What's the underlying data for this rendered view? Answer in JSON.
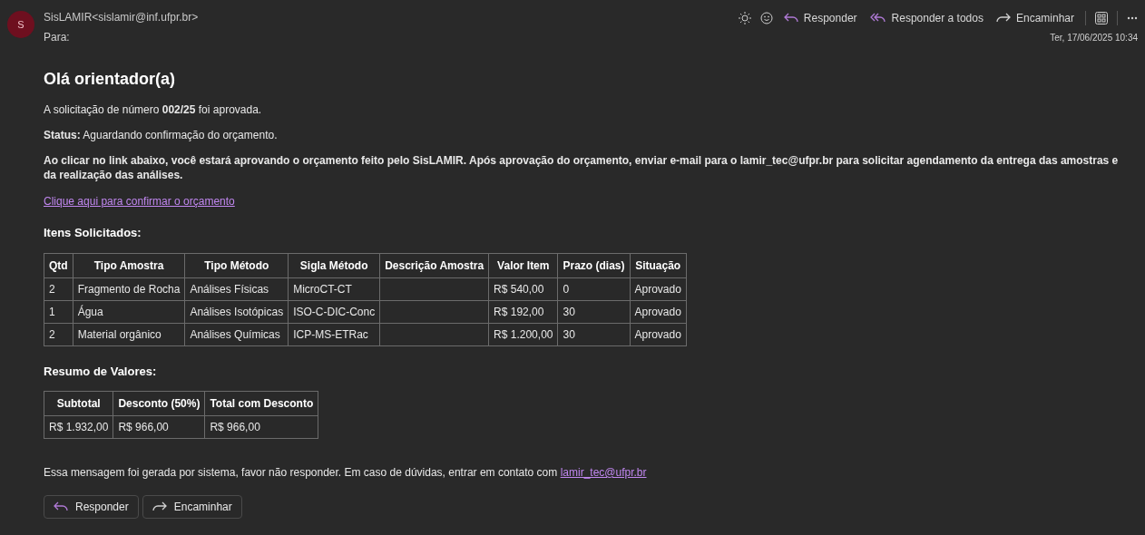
{
  "header": {
    "avatar": "S",
    "sender": "SisLAMIR<sislamir@inf.ufpr.br>",
    "to_label": "Para:",
    "date": "Ter, 17/06/2025 10:34",
    "actions": [
      {
        "kind": "reply",
        "label": "Responder"
      },
      {
        "kind": "reply_all",
        "label": "Responder a todos"
      },
      {
        "kind": "forward",
        "label": "Encaminhar"
      }
    ]
  },
  "body": {
    "greeting": "Olá orientador(a)",
    "paragraphs": [
      {
        "text": "A solicitação de número **002/25** foi aprovada.",
        "bold": false
      },
      {
        "text": "**Status:** Aguardando confirmação do orçamento.",
        "bold": false
      },
      {
        "text": "Ao clicar no link abaixo, você estará aprovando o orçamento feito pelo SisLAMIR. Após aprovação do orçamento, enviar e-mail para o lamir_tec@ufpr.br para solicitar agendamento da entrega das amostras e da realização das análises.",
        "bold": true
      }
    ],
    "link": "Clique aqui para confirmar o orçamento",
    "items_title": "Itens Solicitados:",
    "items_table": {
      "columns": [
        "Qtd",
        "Tipo Amostra",
        "Tipo Método",
        "Sigla Método",
        "Descrição Amostra",
        "Valor Item",
        "Prazo (dias)",
        "Situação"
      ],
      "rows": [
        [
          "2",
          "Fragmento de Rocha",
          "Análises Físicas",
          "MicroCT-CT",
          "",
          "R$ 540,00",
          "0",
          "Aprovado"
        ],
        [
          "1",
          "Água",
          "Análises Isotópicas",
          "ISO-C-DIC-Conc",
          "",
          "R$ 192,00",
          "30",
          "Aprovado"
        ],
        [
          "2",
          "Material orgânico",
          "Análises Químicas",
          "ICP-MS-ETRac",
          "",
          "R$ 1.200,00",
          "30",
          "Aprovado"
        ]
      ]
    },
    "summary_title": "Resumo de Valores:",
    "summary_table": {
      "columns": [
        "Subtotal",
        "Desconto (50%)",
        "Total com Desconto"
      ],
      "rows": [
        [
          "R$ 1.932,00",
          "R$ 966,00",
          "R$ 966,00"
        ]
      ]
    },
    "footer_text": "Essa mensagem foi gerada por sistema, favor não responder. Em caso de dúvidas, entrar em contato com",
    "footer_link": "lamir_tec@ufpr.br"
  },
  "bottom_actions": [
    {
      "kind": "reply",
      "label": "Responder"
    },
    {
      "kind": "forward",
      "label": "Encaminhar"
    }
  ]
}
